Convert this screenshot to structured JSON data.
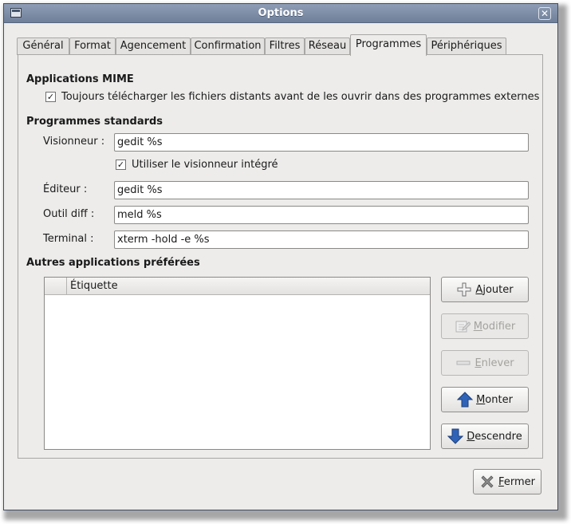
{
  "window": {
    "title": "Options"
  },
  "tabs": [
    {
      "label": "Général"
    },
    {
      "label": "Format"
    },
    {
      "label": "Agencement"
    },
    {
      "label": "Confirmation"
    },
    {
      "label": "Filtres"
    },
    {
      "label": "Réseau"
    },
    {
      "label": "Programmes",
      "active": true
    },
    {
      "label": "Périphériques"
    }
  ],
  "mime": {
    "title": "Applications MIME",
    "download_check": {
      "label": "Toujours télécharger les fichiers distants avant de les ouvrir dans des programmes externes",
      "checked": true
    }
  },
  "standard": {
    "title": "Programmes standards",
    "viewer_label": "Visionneur :",
    "viewer_value": "gedit %s",
    "builtin_viewer_check": {
      "label": "Utiliser le visionneur intégré",
      "checked": true
    },
    "editor_label": "Éditeur :",
    "editor_value": "gedit %s",
    "diff_label": "Outil diff :",
    "diff_value": "meld %s",
    "terminal_label": "Terminal :",
    "terminal_value": "xterm -hold -e %s"
  },
  "preferred": {
    "title": "Autres applications préférées",
    "column_label": "Étiquette",
    "buttons": {
      "add": {
        "mnemonic": "A",
        "rest": "jouter"
      },
      "modify": {
        "mnemonic": "M",
        "rest": "odifier"
      },
      "remove": {
        "mnemonic": "E",
        "rest": "nlever"
      },
      "up": {
        "mnemonic": "M",
        "rest": "onter"
      },
      "down": {
        "mnemonic": "D",
        "rest": "escendre"
      }
    }
  },
  "footer": {
    "close": {
      "mnemonic": "F",
      "rest": "ermer"
    }
  },
  "colors": {
    "titlebar": "#7b8aa3",
    "window_bg": "#edeceb",
    "arrow_blue": "#2f63b8"
  },
  "icons": [
    "window-icon",
    "close-icon",
    "plus-icon",
    "edit-icon",
    "minus-icon",
    "arrow-up-icon",
    "arrow-down-icon",
    "cross-icon",
    "checkmark-icon"
  ]
}
